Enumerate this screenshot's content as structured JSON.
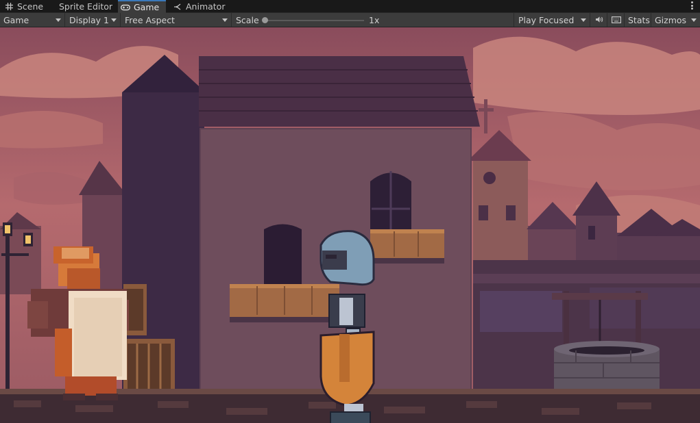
{
  "tabs": [
    {
      "label": "Scene",
      "icon": "grid-icon",
      "active": false
    },
    {
      "label": "Sprite Editor",
      "icon": "",
      "active": false
    },
    {
      "label": "Game",
      "icon": "gamepad-icon",
      "active": true
    },
    {
      "label": "Animator",
      "icon": "animator-icon",
      "active": false
    }
  ],
  "toolbar": {
    "view_mode": "Game",
    "display": "Display 1",
    "aspect": "Free Aspect",
    "scale_label": "Scale",
    "scale_value": "1x",
    "scale_level": 0.0,
    "play_mode": "Play Focused",
    "stats": "Stats",
    "gizmos": "Gizmos"
  },
  "colors": {
    "accent": "#3a79bb",
    "toolbar_bg": "#3c3c3c",
    "tabbar_bg": "#191919"
  }
}
